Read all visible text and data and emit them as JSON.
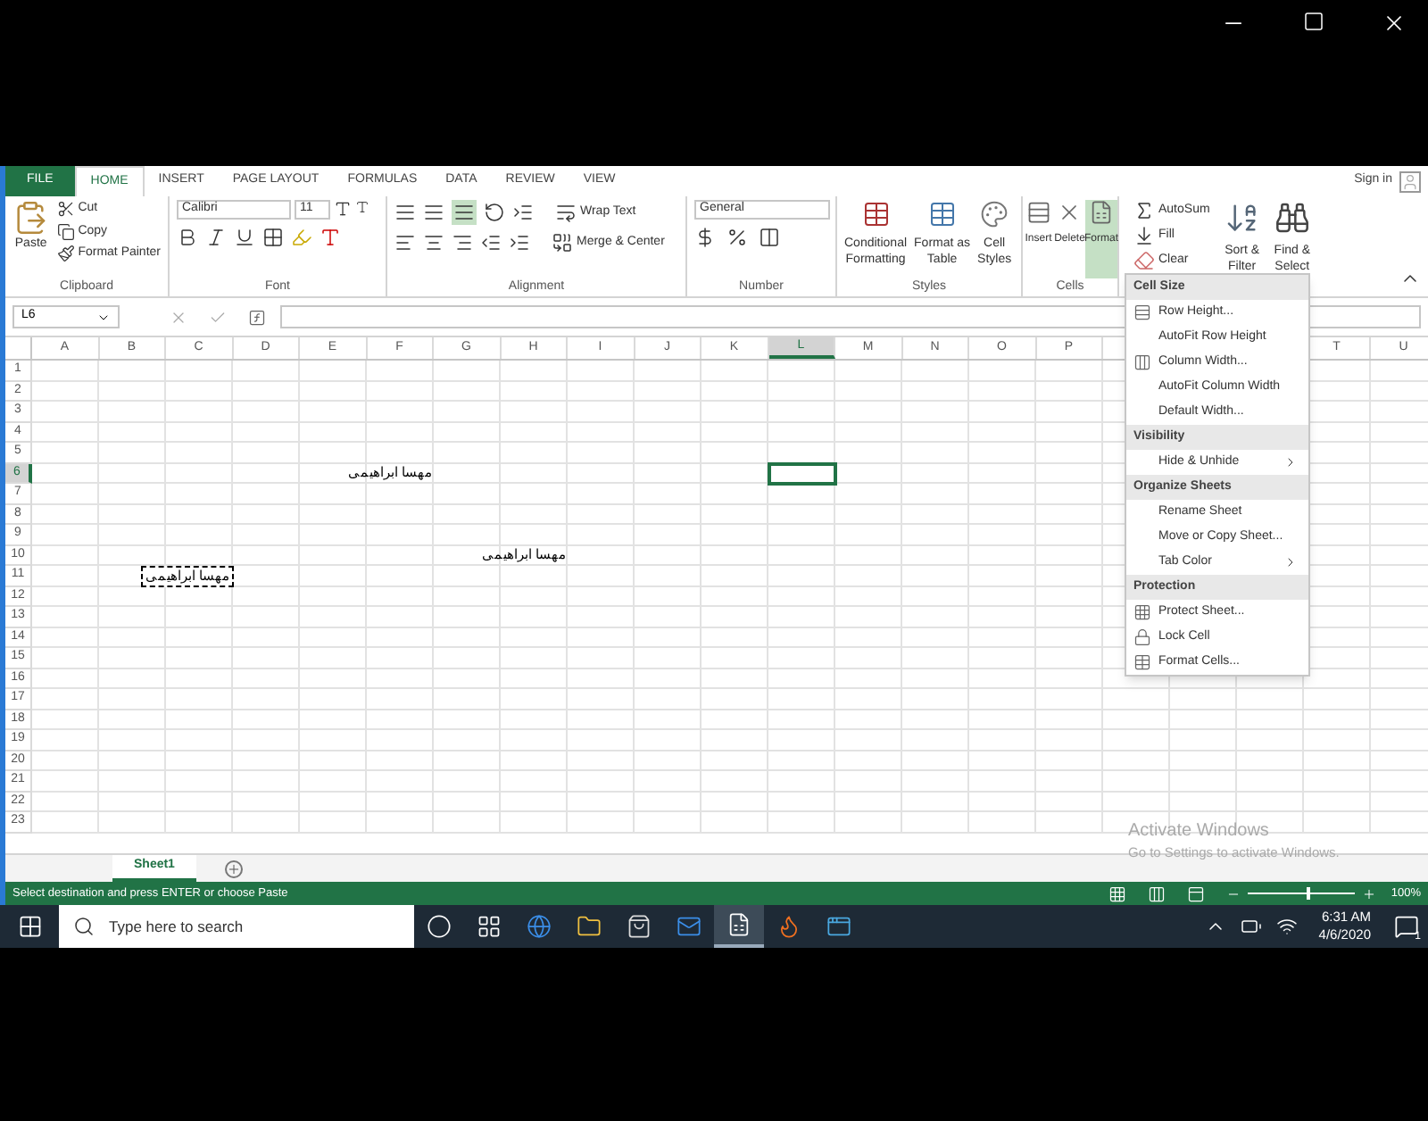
{
  "ribbon_tabs": [
    {
      "label": "FILE",
      "kind": "file",
      "selected": false
    },
    {
      "label": "HOME",
      "kind": "tab",
      "selected": true
    },
    {
      "label": "INSERT",
      "kind": "tab",
      "selected": false
    },
    {
      "label": "PAGE LAYOUT",
      "kind": "tab",
      "selected": false
    },
    {
      "label": "FORMULAS",
      "kind": "tab",
      "selected": false
    },
    {
      "label": "DATA",
      "kind": "tab",
      "selected": false
    },
    {
      "label": "REVIEW",
      "kind": "tab",
      "selected": false
    },
    {
      "label": "VIEW",
      "kind": "tab",
      "selected": false
    }
  ],
  "account": {
    "label": "Sign in"
  },
  "clipboard": {
    "paste": "Paste",
    "cut": "Cut",
    "copy": "Copy",
    "format_painter": "Format Painter",
    "label": "Clipboard"
  },
  "font": {
    "name": "Calibri",
    "size": "11",
    "label": "Font"
  },
  "alignment": {
    "wrap": "Wrap Text",
    "merge": "Merge & Center",
    "label": "Alignment"
  },
  "number": {
    "format": "General",
    "label": "Number"
  },
  "styles": {
    "buttons": [
      {
        "line1": "Conditional",
        "line2": "Formatting"
      },
      {
        "line1": "Format as",
        "line2": "Table"
      },
      {
        "line1": "Cell",
        "line2": "Styles"
      }
    ],
    "label": "Styles"
  },
  "cells": {
    "buttons": [
      {
        "label": "Insert",
        "kind": "insert",
        "selected": false
      },
      {
        "label": "Delete",
        "kind": "delete",
        "selected": false
      },
      {
        "label": "Format",
        "kind": "format",
        "selected": true
      }
    ],
    "label": "Cells"
  },
  "editing": {
    "autosum": "AutoSum",
    "fill": "Fill",
    "clear": "Clear",
    "sort": {
      "line1": "Sort &",
      "line2": "Filter"
    },
    "find": {
      "line1": "Find &",
      "line2": "Select"
    }
  },
  "formula_bar": {
    "name_box": "L6"
  },
  "sheet": {
    "columns": [
      {
        "label": "A",
        "selected": false
      },
      {
        "label": "B",
        "selected": false
      },
      {
        "label": "C",
        "selected": false
      },
      {
        "label": "D",
        "selected": false
      },
      {
        "label": "E",
        "selected": false
      },
      {
        "label": "F",
        "selected": false
      },
      {
        "label": "G",
        "selected": false
      },
      {
        "label": "H",
        "selected": false
      },
      {
        "label": "I",
        "selected": false
      },
      {
        "label": "J",
        "selected": false
      },
      {
        "label": "K",
        "selected": false
      },
      {
        "label": "L",
        "selected": true
      },
      {
        "label": "M",
        "selected": false
      },
      {
        "label": "N",
        "selected": false
      },
      {
        "label": "O",
        "selected": false
      },
      {
        "label": "P",
        "selected": false
      },
      {
        "label": "T",
        "selected": false
      },
      {
        "label": "U",
        "selected": false
      }
    ],
    "rows": [
      {
        "label": "1",
        "selected": false
      },
      {
        "label": "2",
        "selected": false
      },
      {
        "label": "3",
        "selected": false
      },
      {
        "label": "4",
        "selected": false
      },
      {
        "label": "5",
        "selected": false
      },
      {
        "label": "6",
        "selected": true,
        "cells": [
          {},
          {},
          {},
          {},
          {},
          {
            "text": "مهسا ابراهیمی",
            "marquee": false
          }
        ]
      },
      {
        "label": "7",
        "selected": false
      },
      {
        "label": "8",
        "selected": false
      },
      {
        "label": "9",
        "selected": false
      },
      {
        "label": "10",
        "selected": false,
        "cells": [
          {},
          {},
          {},
          {},
          {},
          {},
          {},
          {
            "text": "مهسا ابراهیمی",
            "marquee": false
          }
        ]
      },
      {
        "label": "11",
        "selected": false,
        "cells": [
          {},
          {},
          {
            "text": "مهسا ابراهیمی",
            "marquee": true
          }
        ]
      },
      {
        "label": "12",
        "selected": false
      },
      {
        "label": "13",
        "selected": false
      },
      {
        "label": "14",
        "selected": false
      },
      {
        "label": "15",
        "selected": false
      },
      {
        "label": "16",
        "selected": false
      },
      {
        "label": "17",
        "selected": false
      },
      {
        "label": "18",
        "selected": false
      },
      {
        "label": "19",
        "selected": false
      },
      {
        "label": "20",
        "selected": false
      },
      {
        "label": "21",
        "selected": false
      },
      {
        "label": "22",
        "selected": false
      },
      {
        "label": "23",
        "selected": false
      }
    ]
  },
  "format_menu": {
    "sections": [
      {
        "title": "Cell Size",
        "items": [
          {
            "label": "Row Height...",
            "kind": "row-height",
            "submenu": false
          },
          {
            "label": "AutoFit Row Height",
            "kind": "plain",
            "submenu": false
          },
          {
            "label": "Column Width...",
            "kind": "column-width",
            "submenu": false
          },
          {
            "label": "AutoFit Column Width",
            "kind": "plain",
            "submenu": false
          },
          {
            "label": "Default Width...",
            "kind": "plain",
            "submenu": false
          }
        ]
      },
      {
        "title": "Visibility",
        "items": [
          {
            "label": "Hide & Unhide",
            "kind": "plain",
            "submenu": true
          }
        ]
      },
      {
        "title": "Organize Sheets",
        "items": [
          {
            "label": "Rename Sheet",
            "kind": "plain",
            "submenu": false
          },
          {
            "label": "Move or Copy Sheet...",
            "kind": "plain",
            "submenu": false
          },
          {
            "label": "Tab Color",
            "kind": "plain",
            "submenu": true
          }
        ]
      },
      {
        "title": "Protection",
        "items": [
          {
            "label": "Protect Sheet...",
            "kind": "protect",
            "submenu": false
          },
          {
            "label": "Lock Cell",
            "kind": "lock",
            "submenu": false
          },
          {
            "label": "Format Cells...",
            "kind": "format-cells",
            "submenu": false
          }
        ]
      }
    ]
  },
  "sheet_tabs": [
    {
      "label": "Sheet1",
      "selected": true
    }
  ],
  "activation": {
    "title": "Activate Windows",
    "subtitle": "Go to Settings to activate Windows."
  },
  "status_bar": {
    "message": "Select destination and press ENTER or choose Paste",
    "zoom": {
      "label": "100%",
      "level": 0.55
    }
  },
  "taskbar": {
    "search_placeholder": "Type here to search",
    "apps": [
      {
        "kind": "cortana",
        "selected": false
      },
      {
        "kind": "task-view",
        "selected": false
      },
      {
        "kind": "edge",
        "selected": false
      },
      {
        "kind": "explorer",
        "selected": false
      },
      {
        "kind": "store",
        "selected": false
      },
      {
        "kind": "mail",
        "selected": false
      },
      {
        "kind": "excel",
        "selected": true
      },
      {
        "kind": "firefox",
        "selected": false
      },
      {
        "kind": "app",
        "selected": false
      }
    ],
    "time": "6:31 AM",
    "date": "4/6/2020",
    "notifications": "1"
  }
}
